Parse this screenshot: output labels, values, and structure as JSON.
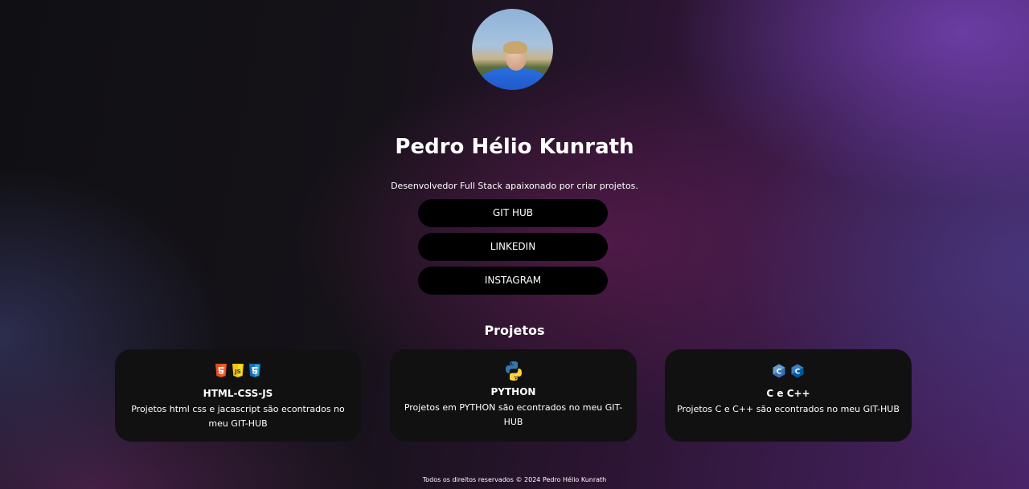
{
  "profile": {
    "name": "Pedro Hélio Kunrath",
    "tagline": "Desenvolvedor Full Stack apaixonado por criar projetos."
  },
  "links": [
    {
      "label": "GIT HUB"
    },
    {
      "label": "LINKEDIN"
    },
    {
      "label": "INSTAGRAM"
    }
  ],
  "projects": {
    "title": "Projetos",
    "cards": [
      {
        "title": "HTML-CSS-JS",
        "description": "Projetos html css e jacascript são econtrados no meu GIT-HUB",
        "icons": [
          "html5-icon",
          "javascript-icon",
          "css3-icon"
        ]
      },
      {
        "title": "PYTHON",
        "description": "Projetos em PYTHON são econtrados no meu GIT-HUB",
        "icons": [
          "python-icon"
        ]
      },
      {
        "title": "C e C++",
        "description": "Projetos C e C++ são econtrados no meu GIT-HUB",
        "icons": [
          "c-icon",
          "cpp-icon"
        ]
      }
    ]
  },
  "footer": {
    "text": "Todos os direitos reservados © 2024 Pedro Hélio Kunrath"
  },
  "colors": {
    "html5": "#e44d26",
    "javascript": "#f0c419",
    "css3": "#1572b6",
    "python_blue": "#3776ab",
    "python_yellow": "#ffd43b",
    "c_blue": "#3a6fb0"
  }
}
